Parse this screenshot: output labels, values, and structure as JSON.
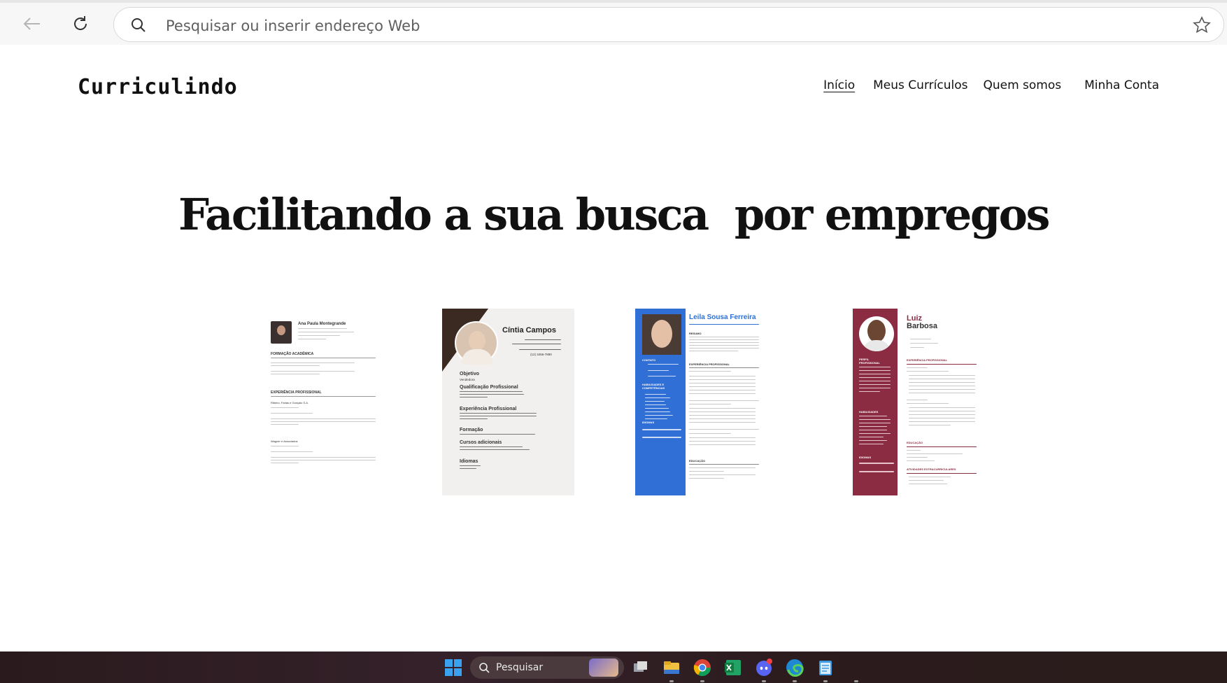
{
  "browser": {
    "address_placeholder": "Pesquisar ou inserir endereço Web"
  },
  "site": {
    "logo": "Curriculindo",
    "nav": [
      "Início",
      "Meus Currículos",
      "Quem somos",
      "Minha Conta"
    ],
    "hero_title": "Facilitando a sua busca  por empregos"
  },
  "resumes": [
    {
      "name": "Ana Paula Montegrande",
      "sections": [
        "FORMAÇÃO ACADÊMICA",
        "EXPERIÊNCIA PROFISSIONAL"
      ],
      "jobs": [
        "Ribeiro, Farias e Gonçalo S.A.",
        "Wagner e Associados"
      ]
    },
    {
      "name": "Cíntia Campos",
      "sections": [
        "Objetivo",
        "Qualificação Profissional",
        "Experiência Profissional",
        "Formação",
        "Cursos adicionais",
        "Idiomas"
      ],
      "objective": "Vendedora",
      "phone": "(12) 3456-7890"
    },
    {
      "name": "Leila Sousa Ferreira",
      "sections": [
        "RESUMO",
        "CONTATO",
        "EXPERIÊNCIA PROFISSIONAL",
        "HABILIDADES E COMPETÊNCIAS",
        "IDIOMAS",
        "EDUCAÇÃO"
      ],
      "accent": "#2f6fd6"
    },
    {
      "name_first": "Luiz",
      "name_last": "Barbosa",
      "sections": [
        "PERFIL PROFISSIONAL",
        "EXPERIÊNCIA PROFISSIONAL",
        "HABILIDADES",
        "IDIOMAS",
        "EDUCAÇÃO",
        "ATIVIDADES EXTRACURRICULARES"
      ],
      "accent": "#8b2c42"
    }
  ],
  "taskbar": {
    "search_label": "Pesquisar"
  },
  "colors": {
    "resume3_sidebar": "#2f6fd6",
    "resume4_sidebar": "#8b2c42",
    "resume2_corner": "#3a2a22"
  }
}
